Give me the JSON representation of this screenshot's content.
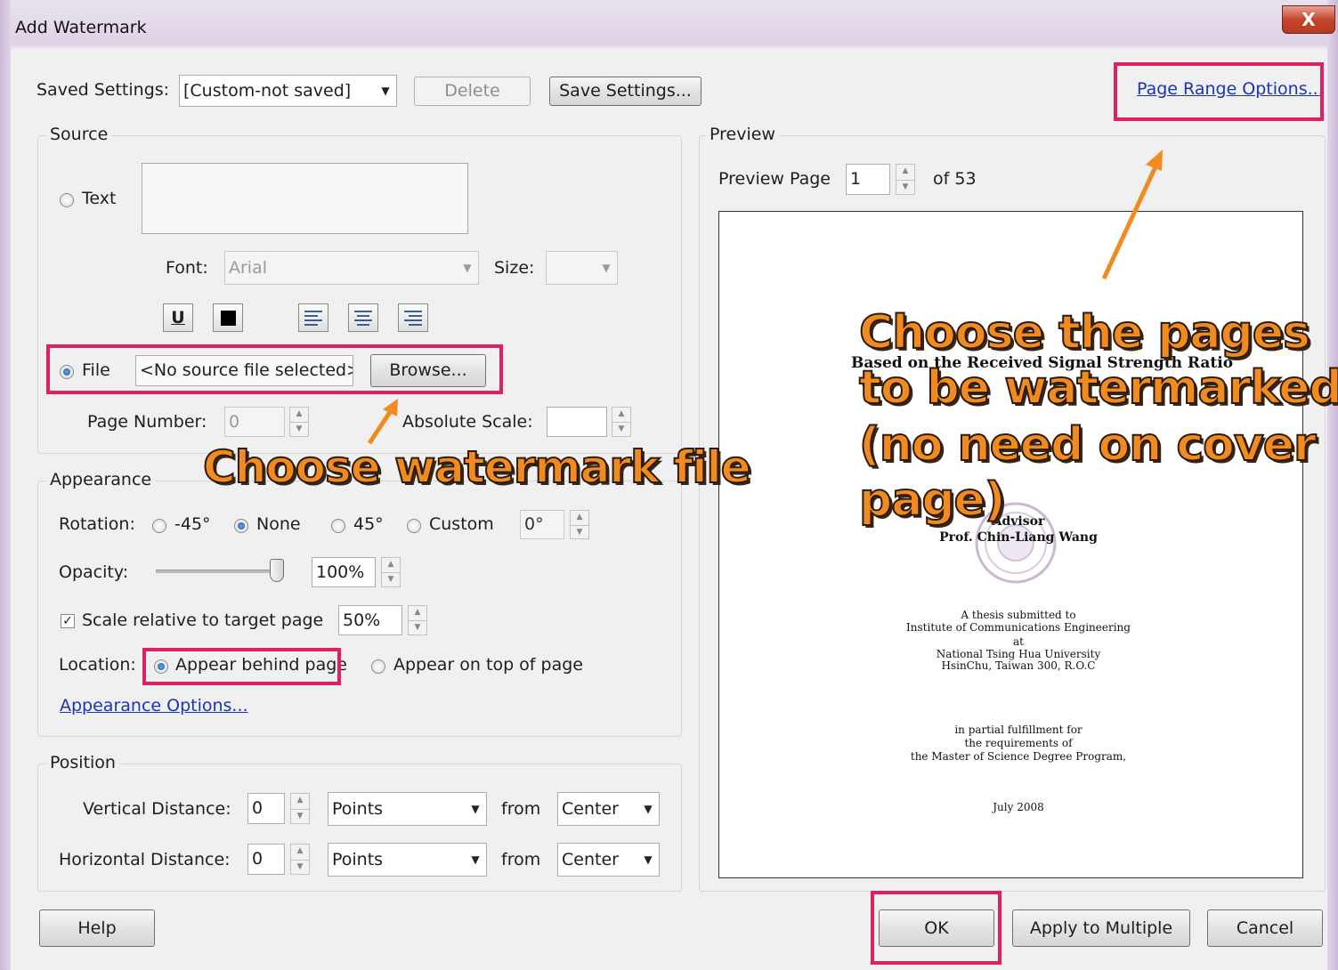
{
  "window": {
    "title": "Add Watermark",
    "close_label": "X"
  },
  "saved_settings": {
    "label": "Saved Settings:",
    "value": "[Custom-not saved]",
    "delete_label": "Delete",
    "save_label": "Save Settings..."
  },
  "page_range_link": "Page Range Options...",
  "source": {
    "legend": "Source",
    "text_label": "Text",
    "font_label": "Font:",
    "font_value": "Arial",
    "size_label": "Size:",
    "file_label": "File",
    "file_value": "<No source file selected>",
    "browse_label": "Browse...",
    "page_number_label": "Page Number:",
    "page_number_value": "0",
    "absolute_scale_label": "Absolute Scale:",
    "underline_icon": "U"
  },
  "appearance": {
    "legend": "Appearance",
    "rotation_label": "Rotation:",
    "rotation_options": [
      "-45°",
      "None",
      "45°",
      "Custom"
    ],
    "rotation_custom_value": "0°",
    "opacity_label": "Opacity:",
    "opacity_value": "100%",
    "scale_label": "Scale relative to target page",
    "scale_value": "50%",
    "location_label": "Location:",
    "location_behind": "Appear behind page",
    "location_top": "Appear on top of page",
    "options_link": "Appearance Options..."
  },
  "position": {
    "legend": "Position",
    "vertical_label": "Vertical Distance:",
    "vertical_value": "0",
    "vertical_unit": "Points",
    "vertical_from": "from",
    "vertical_anchor": "Center",
    "horizontal_label": "Horizontal Distance:",
    "horizontal_value": "0",
    "horizontal_unit": "Points",
    "horizontal_from": "from",
    "horizontal_anchor": "Center"
  },
  "preview": {
    "legend": "Preview",
    "page_label": "Preview Page",
    "page_value": "1",
    "page_of": "of 53",
    "doc": {
      "subtitle": "Based on the Received Signal Strength Ratio",
      "advisor_label": "Advisor",
      "advisor_name": "Prof. Chin-Liang Wang",
      "submitted_lines": [
        "A thesis submitted to",
        "Institute of Communications Engineering",
        "at",
        "National Tsing Hua University",
        "HsinChu, Taiwan 300, R.O.C"
      ],
      "fulfillment_lines": [
        "in partial fulfillment for",
        "the requirements of",
        "the Master of Science Degree Program,"
      ],
      "date": "July 2008"
    }
  },
  "buttons": {
    "help": "Help",
    "ok": "OK",
    "apply_multiple": "Apply to Multiple",
    "cancel": "Cancel"
  },
  "annotations": {
    "watermark_file": "Choose watermark file",
    "pages_lines": [
      "Choose the pages",
      "to be watermarked",
      "(no need on cover",
      "page)"
    ]
  },
  "colors": {
    "highlight": "#e1205f",
    "annotation": "#f18b1f",
    "link": "#1a33bf"
  }
}
